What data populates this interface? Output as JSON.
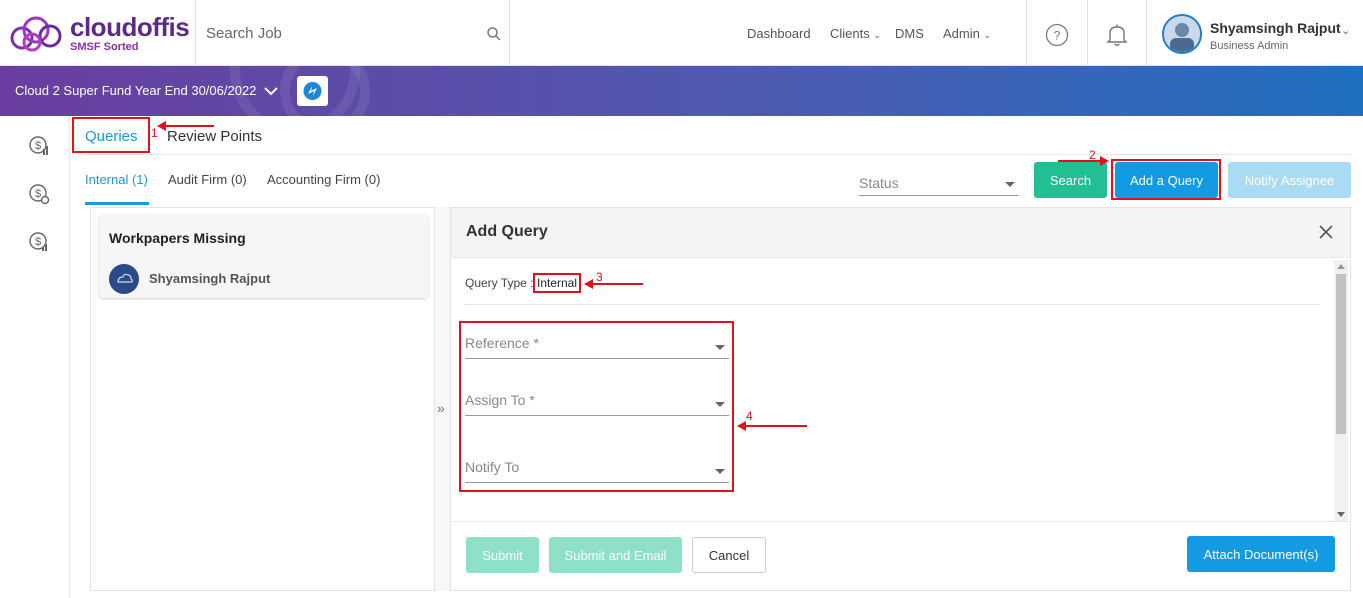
{
  "header": {
    "logo_text": "cloudoffis",
    "logo_sub": "SMSF Sorted",
    "search_placeholder": "Search Job",
    "nav": {
      "dashboard": "Dashboard",
      "clients": "Clients",
      "dms": "DMS",
      "admin": "Admin"
    },
    "user": {
      "name": "Shyamsingh Rajput",
      "role": "Business Admin"
    }
  },
  "job_bar": {
    "title": "Cloud 2 Super Fund Year End 30/06/2022"
  },
  "main_tabs": {
    "queries": "Queries",
    "review_points": "Review Points"
  },
  "sub_tabs": {
    "internal": "Internal (1)",
    "audit_firm": "Audit Firm (0)",
    "accounting_firm": "Accounting Firm (0)"
  },
  "filters": {
    "status_placeholder": "Status",
    "search_label": "Search",
    "add_query_label": "Add a Query",
    "notify_assignee_label": "Notify Assignee"
  },
  "query_list": [
    {
      "title": "Workpapers Missing",
      "assignee": "Shyamsingh Rajput"
    }
  ],
  "add_query": {
    "title": "Add Query",
    "query_type_label": "Query Type :",
    "query_type_value": "Internal",
    "reference_placeholder": "Reference *",
    "assign_to_placeholder": "Assign To *",
    "notify_to_placeholder": "Notify To",
    "submit_label": "Submit",
    "submit_email_label": "Submit and Email",
    "cancel_label": "Cancel",
    "attach_label": "Attach Document(s)"
  },
  "annotations": {
    "n1": "1",
    "n2": "2",
    "n3": "3",
    "n4": "4"
  },
  "colors": {
    "brand_purple": "#5b2a8c",
    "accent_blue": "#1aa0e6",
    "search_green": "#22bf94",
    "annotation_red": "#e0121b"
  }
}
